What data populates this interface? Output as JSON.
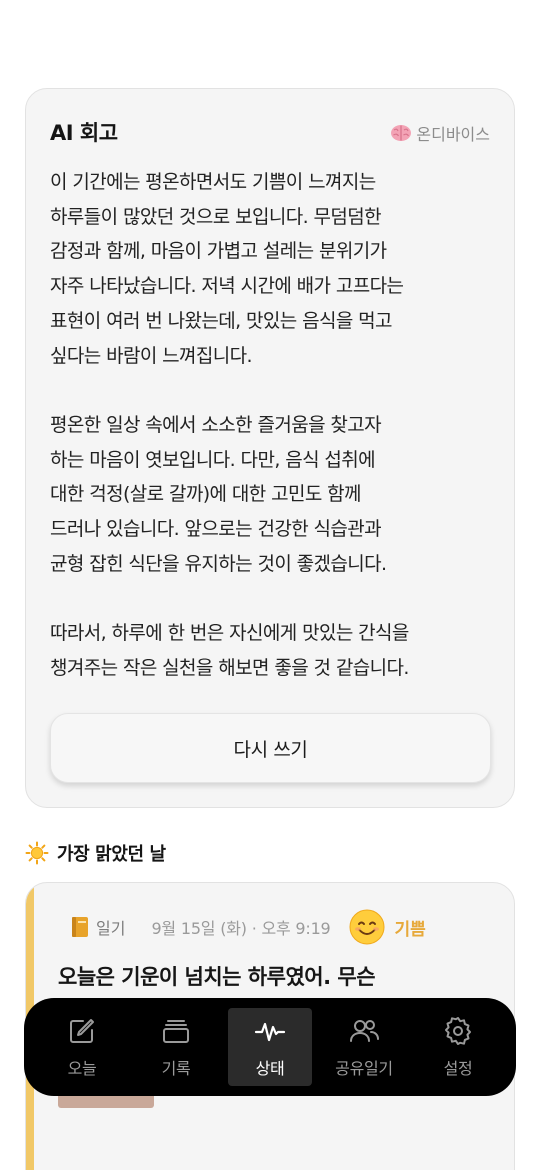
{
  "ai_retrospective": {
    "title": "AI 회고",
    "badge_icon": "brain-icon",
    "badge_label": "온디바이스",
    "paragraphs": [
      [
        "이 기간에는 평온하면서도 기쁨이 느껴지는",
        "하루들이 많았던 것으로 보입니다. 무덤덤한",
        "감정과 함께, 마음이 가볍고 설레는 분위기가",
        "자주 나타났습니다. 저녁 시간에 배가 고프다는",
        "표현이 여러 번 나왔는데, 맛있는 음식을 먹고",
        "싶다는 바람이 느껴집니다."
      ],
      [
        "평온한 일상 속에서 소소한 즐거움을 찾고자",
        "하는 마음이 엿보입니다. 다만, 음식 섭취에",
        "대한 걱정(살로 갈까)에 대한 고민도 함께",
        "드러나 있습니다. 앞으로는 건강한 식습관과",
        "균형 잡힌 식단을 유지하는 것이 좋겠습니다."
      ],
      [
        "따라서, 하루에 한 번은 자신에게 맛있는 간식을",
        "챙겨주는 작은 실천을 해보면 좋을 것 같습니다."
      ]
    ],
    "rewrite_button": "다시 쓰기"
  },
  "brightest_day": {
    "icon": "sun-icon",
    "title": "가장 맑았던 날",
    "entry": {
      "type_icon": "notebook-icon",
      "type_label": "일기",
      "date": "9월 15일 (화) · 오후 9:19",
      "mood_icon": "smiling-face-icon",
      "mood_label": "기쁨",
      "text": "오늘은 기운이 넘치는 하루였어. 무슨"
    }
  },
  "tabbar": {
    "items": [
      {
        "icon": "compose-icon",
        "label": "오늘",
        "active": false
      },
      {
        "icon": "stack-icon",
        "label": "기록",
        "active": false
      },
      {
        "icon": "pulse-icon",
        "label": "상태",
        "active": true
      },
      {
        "icon": "people-icon",
        "label": "공유일기",
        "active": false
      },
      {
        "icon": "gear-icon",
        "label": "설정",
        "active": false
      }
    ]
  },
  "colors": {
    "card_background": "#f5f5f5",
    "accent_yellow": "#f1c867",
    "mood_color": "#e7a93a",
    "tabbar_background": "#000000",
    "tab_active_background": "#2b2b2b"
  }
}
